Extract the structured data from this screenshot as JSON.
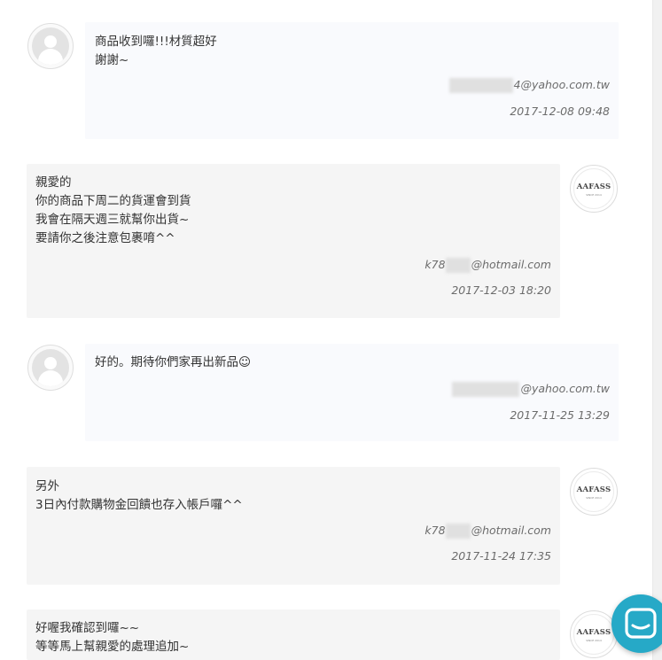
{
  "messages": [
    {
      "lines": [
        "商品收到囉!!!材質超好",
        "謝謝~"
      ],
      "email_suffix": "4@yahoo.com.tw",
      "date": "2017-12-08 09:48"
    },
    {
      "lines": [
        "親愛的",
        "你的商品下周二的貨運會到貨",
        "我會在隔天週三就幫你出貨~",
        "要請你之後注意包裹唷^^"
      ],
      "email_prefix": "k78",
      "email_suffix": "@hotmail.com",
      "date": "2017-12-03 18:20"
    },
    {
      "lines": [
        "好的。期待你們家再出新品☺"
      ],
      "email_suffix": "@yahoo.com.tw",
      "date": "2017-11-25 13:29"
    },
    {
      "lines": [
        "另外",
        "3日內付款購物金回饋也存入帳戶囉^^"
      ],
      "email_prefix": "k78",
      "email_suffix": "@hotmail.com",
      "date": "2017-11-24 17:35"
    },
    {
      "lines": [
        "好喔我確認到囉~~",
        "等等馬上幫親愛的處理追加~"
      ]
    }
  ],
  "shop_logo": {
    "name": "AAFASS",
    "tagline": "SINCE 2014"
  },
  "colors": {
    "user_bubble": "#f9fafd",
    "shop_bubble": "#f5f5f5",
    "chat_button": "#26a9c7"
  },
  "icons": {
    "user_avatar": "user-silhouette-icon",
    "chat": "chat-bubble-icon"
  }
}
